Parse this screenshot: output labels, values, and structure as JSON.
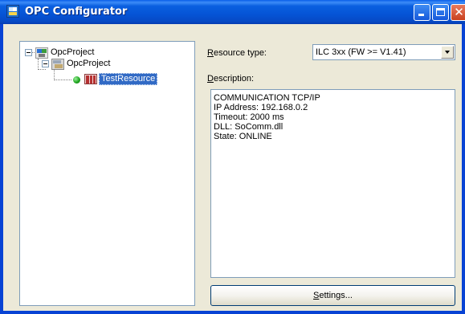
{
  "window": {
    "title": "OPC Configurator",
    "controls": {
      "minimize": "minimize",
      "maximize": "maximize",
      "close": "✕"
    }
  },
  "tree": {
    "root": {
      "label": "OpcProject",
      "icon": "project-icon",
      "expanded": true
    },
    "child": {
      "label": "OpcProject",
      "icon": "project-folder-icon",
      "expanded": true
    },
    "leaf": {
      "label": "TestResource",
      "icon": "resource-icon",
      "status_icon": "online-status-icon",
      "selected": true
    }
  },
  "resource_type": {
    "label_prefix": "",
    "label_mnemonic": "R",
    "label_rest": "esource type:",
    "selected": "ILC 3xx (FW >= V1.41)"
  },
  "description": {
    "label_mnemonic": "D",
    "label_rest": "escription:",
    "lines": [
      "COMMUNICATION TCP/IP",
      "IP Address: 192.168.0.2",
      "Timeout: 2000 ms",
      "DLL: SoComm.dll",
      "State: ONLINE"
    ]
  },
  "settings_button": {
    "mnemonic": "S",
    "rest": "ettings..."
  },
  "colors": {
    "titlebar": "#0554d6",
    "selection": "#316ac5",
    "window_bg": "#ece9d8",
    "status_online": "#19a019"
  }
}
